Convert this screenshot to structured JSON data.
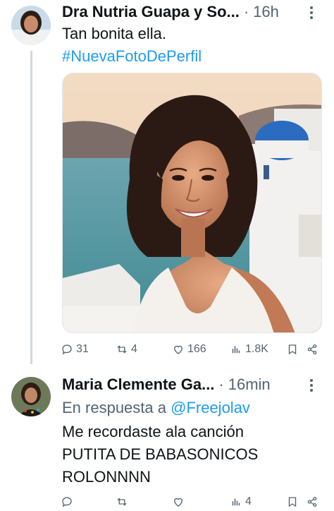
{
  "post1": {
    "author": "Dra Nutria Guapa y So...",
    "separator": "·",
    "time": "16h",
    "text": "Tan bonita ella.",
    "hashtag": "#NuevaFotoDePerfil",
    "actions": {
      "replies": "31",
      "reposts": "4",
      "likes": "166",
      "views": "1.8K"
    }
  },
  "post2": {
    "author": "Maria Clemente Ga...",
    "separator": "·",
    "time": "16min",
    "reply_prefix": "En respuesta a",
    "reply_handle": "@Freejolav",
    "lines": [
      "Me recordaste ala canción",
      "PUTITA DE BABASONICOS",
      "ROLONNNN"
    ],
    "actions": {
      "replies": "",
      "reposts": "",
      "likes": "",
      "views": "4"
    }
  },
  "colors": {
    "accent": "#1d9bf0",
    "muted": "#536471",
    "text": "#0f1419"
  }
}
